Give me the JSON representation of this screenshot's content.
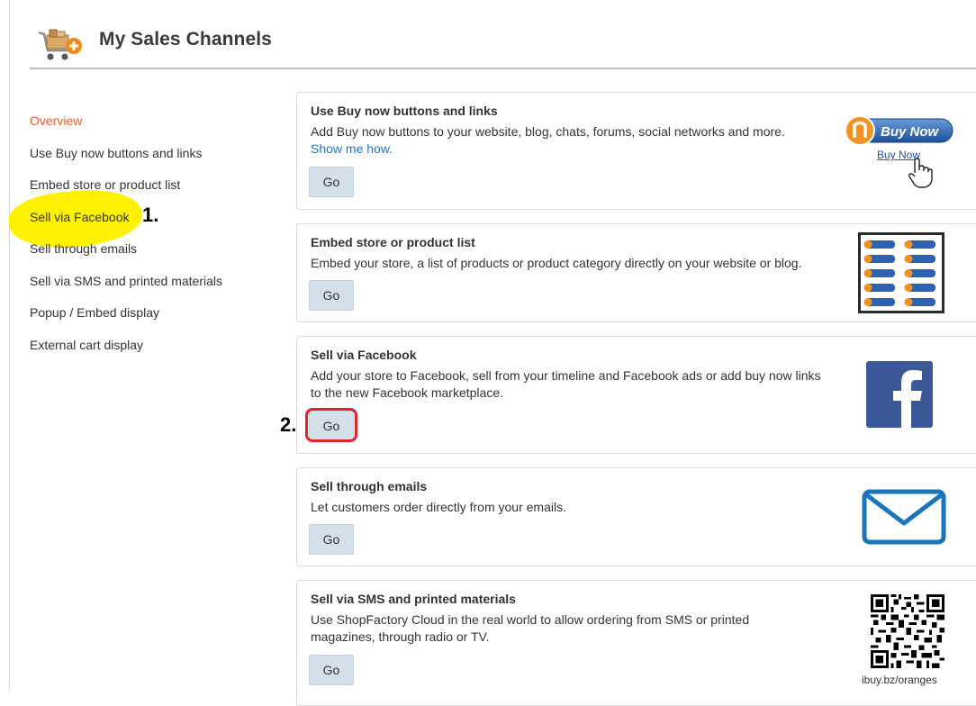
{
  "header": {
    "title": "My Sales Channels",
    "icon": "cart-add-icon"
  },
  "sidebar": {
    "items": [
      {
        "label": "Overview",
        "active": true
      },
      {
        "label": "Use Buy now buttons and links"
      },
      {
        "label": "Embed store or product list"
      },
      {
        "label": "Sell via Facebook"
      },
      {
        "label": "Sell through emails"
      },
      {
        "label": "Sell via SMS and printed materials"
      },
      {
        "label": "Popup / Embed display"
      },
      {
        "label": "External cart display"
      }
    ]
  },
  "annotations": {
    "step1": "1.",
    "step2": "2."
  },
  "cards": [
    {
      "title": "Use Buy now buttons and links",
      "description": "Add Buy now buttons to your website, blog, chats, forums, social networks and more.",
      "link": "Show me how.",
      "button": "Go",
      "image": {
        "button_label": "Buy Now",
        "link_label": "Buy Now",
        "icon": "buy-now-icon"
      }
    },
    {
      "title": "Embed store or product list",
      "description": "Embed your store, a list of products or product category directly on your website or blog.",
      "button": "Go",
      "image": {
        "icon": "product-grid-icon"
      }
    },
    {
      "title": "Sell via Facebook",
      "description": "Add your store to Facebook, sell from your timeline and Facebook ads or add buy now links to the new Facebook marketplace.",
      "button": "Go",
      "image": {
        "icon": "facebook-icon"
      }
    },
    {
      "title": "Sell through emails",
      "description": "Let customers order directly from your emails.",
      "button": "Go",
      "image": {
        "icon": "envelope-icon"
      }
    },
    {
      "title": "Sell via SMS and printed materials",
      "description": "Use ShopFactory Cloud in the real world to allow ordering from SMS or printed magazines, through radio or TV.",
      "button": "Go",
      "image": {
        "icon": "qr-code-icon",
        "caption": "ibuy.bz/oranges"
      }
    }
  ],
  "colors": {
    "accent": "#f0592a",
    "link": "#2277cc",
    "button_bg": "#d3e0ea",
    "highlight": "#fff200",
    "annotation_ring": "#e0242b",
    "facebook": "#3b5998",
    "email": "#1a75ba"
  }
}
